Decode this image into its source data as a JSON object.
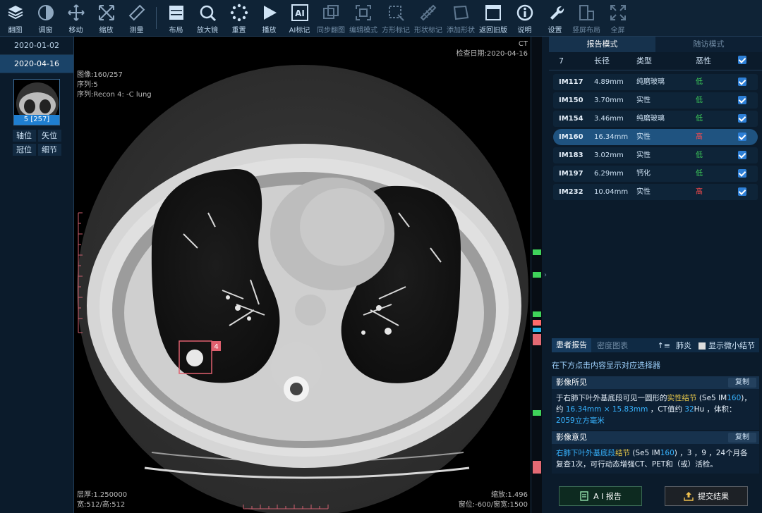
{
  "toolbar": {
    "items": [
      {
        "label": "翻图",
        "icon": "layers-icon"
      },
      {
        "label": "调窗",
        "icon": "contrast-icon"
      },
      {
        "label": "移动",
        "icon": "move-icon"
      },
      {
        "label": "缩放",
        "icon": "resize-icon"
      },
      {
        "label": "测量",
        "icon": "ruler-icon"
      },
      {
        "label": "布局",
        "icon": "layout-icon"
      },
      {
        "label": "放大镜",
        "icon": "magnifier-icon"
      },
      {
        "label": "重置",
        "icon": "reset-icon"
      },
      {
        "label": "播放",
        "icon": "play-icon"
      },
      {
        "label": "AI标记",
        "icon": "ai-mark-icon"
      },
      {
        "label": "同步翻图",
        "icon": "sync-icon"
      },
      {
        "label": "编辑模式",
        "icon": "edit-mode-icon"
      },
      {
        "label": "方形标记",
        "icon": "square-mark-icon"
      },
      {
        "label": "形状标记",
        "icon": "shape-mark-icon"
      },
      {
        "label": "添加形状",
        "icon": "add-shape-icon"
      },
      {
        "label": "返回旧版",
        "icon": "old-version-icon"
      },
      {
        "label": "说明",
        "icon": "info-icon"
      },
      {
        "label": "设置",
        "icon": "wrench-icon"
      },
      {
        "label": "竖屏布局",
        "icon": "portrait-icon"
      },
      {
        "label": "全屏",
        "icon": "fullscreen-icon"
      }
    ]
  },
  "studies": [
    {
      "date": "2020-01-02"
    },
    {
      "date": "2020-04-16"
    }
  ],
  "series_thumb": {
    "badge": "5 [257]"
  },
  "views": [
    "轴位",
    "矢位",
    "冠位",
    "细节"
  ],
  "viewer": {
    "modality": "CT",
    "exam_date": "检查日期:2020-04-16",
    "image_info": "图像:160/257",
    "series_info": "序列:5",
    "series_desc": "序列:Recon 4: -C lung",
    "thickness": "层厚:1.250000",
    "size": "宽:512/高:512",
    "zoom": "缩放:1.496",
    "window": "窗位:-600/窗宽:1500",
    "nodule_tag": "4",
    "colors": {
      "bg": "#000000",
      "mark": "#e0606f"
    }
  },
  "right": {
    "tabs": [
      "报告模式",
      "随访模式"
    ],
    "table": {
      "count": "7",
      "headers": [
        "长径",
        "类型",
        "恶性"
      ],
      "rows": [
        {
          "im": "IM117",
          "len": "4.89mm",
          "type": "纯磨玻璃",
          "risk": "低",
          "level": "low"
        },
        {
          "im": "IM150",
          "len": "3.70mm",
          "type": "实性",
          "risk": "低",
          "level": "low"
        },
        {
          "im": "IM154",
          "len": "3.46mm",
          "type": "纯磨玻璃",
          "risk": "低",
          "level": "low"
        },
        {
          "im": "IM160",
          "len": "16.34mm",
          "type": "实性",
          "risk": "高",
          "level": "high"
        },
        {
          "im": "IM183",
          "len": "3.02mm",
          "type": "实性",
          "risk": "低",
          "level": "low"
        },
        {
          "im": "IM197",
          "len": "6.29mm",
          "type": "钙化",
          "risk": "低",
          "level": "low"
        },
        {
          "im": "IM232",
          "len": "10.04mm",
          "type": "实性",
          "risk": "高",
          "level": "high"
        }
      ]
    },
    "report_tabs": {
      "active": "患者报告",
      "inactive": "密度图表",
      "sort": "↑≡",
      "category": "肺炎",
      "toggle": "显示微小结节"
    },
    "hint": "在下方点击内容显示对应选择器",
    "findings": {
      "title": "影像所见",
      "copy": "复制",
      "p1": "于右肺下叶外基底段可见一圆形的",
      "p2": "实性结节",
      "p3": " (Se5 IM",
      "p4": "160",
      "p5": ")，约 ",
      "p6": "16.34mm × 15.83mm",
      "p7": " ，CT值约 ",
      "p8": "32",
      "p9": "Hu ，体积：",
      "p10": "2059立方毫米"
    },
    "opinion": {
      "title": "影像意见",
      "copy": "复制",
      "p1": "右肺下叶外基底段",
      "p2": "结节",
      "p3": " (Se5 IM",
      "p4": "160",
      "p5": ") ，3 ，9 ，24个月各复查1次，可行动态增强CT、PET和（或）活检。"
    },
    "buttons": {
      "ai_report": "A I 报告",
      "submit": "提交结果"
    }
  }
}
